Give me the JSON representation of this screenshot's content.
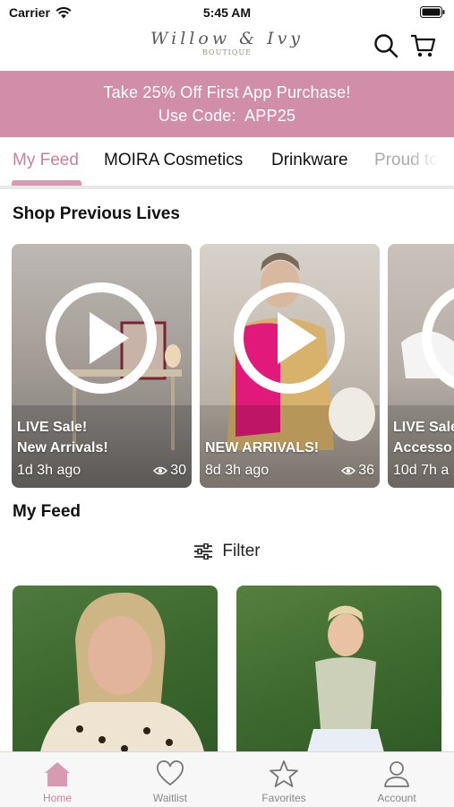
{
  "status_bar": {
    "carrier": "Carrier",
    "time": "5:45 AM"
  },
  "header": {
    "logo_main": "Willow & Ivy",
    "logo_sub": "BOUTIQUE"
  },
  "promo": {
    "line1": "Take 25% Off First App Purchase!",
    "line2": "Use Code:  APP25"
  },
  "tabs": [
    {
      "label": "My Feed",
      "active": true
    },
    {
      "label": "MOIRA Cosmetics"
    },
    {
      "label": "Drinkware"
    },
    {
      "label": "Proud to"
    }
  ],
  "previous_lives": {
    "title": "Shop Previous Lives",
    "cards": [
      {
        "line1": "LIVE Sale!",
        "line2": "New Arrivals!",
        "age": "1d 3h ago",
        "views": "30"
      },
      {
        "line1": "NEW ARRIVALS!",
        "line2": "",
        "age": "8d 3h ago",
        "views": "36"
      },
      {
        "line1": "LIVE Sale",
        "line2": "Accesso",
        "age": "10d 7h a",
        "views": ""
      }
    ]
  },
  "feed": {
    "title": "My Feed",
    "filter_label": "Filter"
  },
  "bottom_nav": [
    {
      "label": "Home",
      "icon": "home-icon",
      "active": true
    },
    {
      "label": "Waitlist",
      "icon": "heart-icon"
    },
    {
      "label": "Favorites",
      "icon": "star-icon"
    },
    {
      "label": "Account",
      "icon": "person-icon"
    }
  ],
  "colors": {
    "accent": "#c98099",
    "promo_bg": "#d18ea8"
  }
}
